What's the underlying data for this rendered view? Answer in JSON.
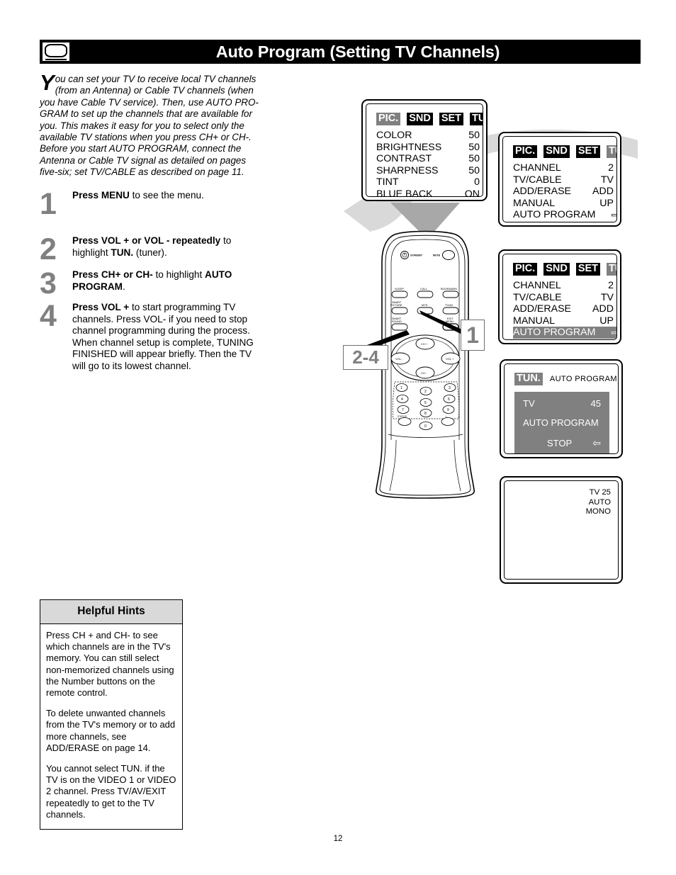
{
  "header": {
    "title": "Auto Program (Setting TV Channels)",
    "tv_icon": "tv-icon"
  },
  "intro": {
    "dropcap": "Y",
    "text": "ou can set your TV to receive local TV channels (from an Antenna) or Cable TV channels (when you have Cable TV service).  Then, use AUTO PRO-GRAM to set up the channels that are available for you. This makes it easy for you to select only the available TV stations when you press CH+ or CH-. Before you start AUTO PROGRAM, connect the Antenna or Cable TV signal as detailed on pages five-six; set TV/CABLE as described on page 11."
  },
  "steps": [
    {
      "num": "1",
      "bold1": "Press MENU",
      "rest1": " to see the menu.",
      "bold2": "",
      "rest2": "",
      "extra": ""
    },
    {
      "num": "2",
      "bold1": "Press VOL + or VOL - repeatedly",
      "rest1": " to highlight ",
      "bold2": "TUN.",
      "rest2": " (tuner).",
      "extra": ""
    },
    {
      "num": "3",
      "bold1": "Press CH+ or CH-",
      "rest1": " to highlight ",
      "bold2": "AUTO PROGRAM",
      "rest2": ".",
      "extra": ""
    },
    {
      "num": "4",
      "bold1": "Press VOL +",
      "rest1": " to start programming TV channels. Press VOL- if you need to stop channel programming during the process.",
      "bold2": "",
      "rest2": "",
      "extra": "When channel setup is complete, TUNING FINISHED will appear briefly. Then the TV will go to its lowest channel."
    }
  ],
  "screens": {
    "picture_menu": {
      "tabs": [
        {
          "label": "PIC.",
          "selected": true
        },
        {
          "label": "SND",
          "selected": false
        },
        {
          "label": "SET",
          "selected": false
        },
        {
          "label": "TUN.",
          "selected": false
        }
      ],
      "rows": [
        {
          "label": "COLOR",
          "value": "50",
          "highlighted": false
        },
        {
          "label": "BRIGHTNESS",
          "value": "50",
          "highlighted": false
        },
        {
          "label": "CONTRAST",
          "value": "50",
          "highlighted": false
        },
        {
          "label": "SHARPNESS",
          "value": "50",
          "highlighted": false
        },
        {
          "label": "TINT",
          "value": "0",
          "highlighted": false
        },
        {
          "label": "BLUE BACK",
          "value": "ON",
          "highlighted": false
        }
      ]
    },
    "tuner_menu": {
      "tabs": [
        {
          "label": "PIC.",
          "selected": false
        },
        {
          "label": "SND",
          "selected": false
        },
        {
          "label": "SET",
          "selected": false
        },
        {
          "label": "TUN.",
          "selected": true
        }
      ],
      "rows": [
        {
          "label": "CHANNEL",
          "value": "2",
          "highlighted": false
        },
        {
          "label": "TV/CABLE",
          "value": "TV",
          "highlighted": false
        },
        {
          "label": "ADD/ERASE",
          "value": "ADD",
          "highlighted": false
        },
        {
          "label": "MANUAL",
          "value": "UP",
          "highlighted": false
        },
        {
          "label": "AUTO PROGRAM",
          "value": "⇨",
          "highlighted": false
        }
      ]
    },
    "tuner_menu_highlighted": {
      "tabs": [
        {
          "label": "PIC.",
          "selected": false
        },
        {
          "label": "SND",
          "selected": false
        },
        {
          "label": "SET",
          "selected": false
        },
        {
          "label": "TUN.",
          "selected": true
        }
      ],
      "rows": [
        {
          "label": "CHANNEL",
          "value": "2",
          "highlighted": false
        },
        {
          "label": "TV/CABLE",
          "value": "TV",
          "highlighted": false
        },
        {
          "label": "ADD/ERASE",
          "value": "ADD",
          "highlighted": false
        },
        {
          "label": "MANUAL",
          "value": "UP",
          "highlighted": false
        },
        {
          "label": "AUTO PROGRAM",
          "value": "⇨",
          "highlighted": true
        }
      ]
    },
    "auto_program_running": {
      "tab_label": "TUN.",
      "title": "AUTO PROGRAM",
      "source_label": "TV",
      "source_value": "45",
      "status": "AUTO PROGRAM",
      "stop_label": "STOP",
      "stop_arrow": "⇦"
    },
    "final_channel": {
      "osd_line1": "TV 25",
      "osd_line2": "AUTO",
      "osd_line3": "MONO"
    }
  },
  "callouts": {
    "one": "1",
    "two_four": "2-4"
  },
  "remote": {
    "standby_label": "STANDBY",
    "mute_label": "MUTE",
    "buttons": [
      "SLEEP",
      "CALL",
      "BOOKMARK",
      "SMART PICTURE",
      "MTS",
      "TV/AV",
      "SMART SOUND",
      "EXIT MENU"
    ],
    "nav": {
      "up": "CH +",
      "down": "CH -",
      "left": "VOL -",
      "right": "VOL +"
    },
    "numpad": [
      "1",
      "2",
      "3",
      "4",
      "5",
      "6",
      "7",
      "8",
      "9",
      "0"
    ],
    "numpad_extra": [
      "STATUS",
      "-/--"
    ]
  },
  "hints": {
    "title": "Helpful Hints",
    "paragraphs": [
      "Press CH + and CH- to see which channels are in the TV's memory. You can still select non-memorized channels using the Number buttons on the remote control.",
      "To delete unwanted channels from the TV's memory or to add more channels, see ADD/ERASE on page 14.",
      "You cannot select TUN. if the TV is on the VIDEO 1 or VIDEO 2 channel. Press TV/AV/EXIT repeatedly to get to the TV channels."
    ]
  },
  "footer": {
    "page_number": "12"
  },
  "colors": {
    "highlight_gray": "#808080",
    "hint_header_gray": "#d9d9d9",
    "swoosh_gray": "#d5d5d5"
  }
}
